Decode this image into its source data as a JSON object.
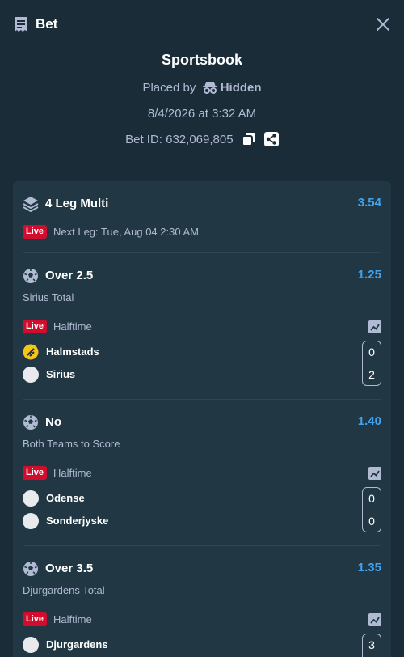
{
  "header": {
    "title": "Bet"
  },
  "summary": {
    "title": "Sportsbook",
    "placed_by_label": "Placed by",
    "placed_by_user": "Hidden",
    "datetime": "8/4/2026 at 3:32 AM",
    "bet_id": "Bet ID: 632,069,805"
  },
  "multi": {
    "title": "4 Leg Multi",
    "odds": "3.54",
    "live_label": "Live",
    "next_leg": "Next Leg: Tue, Aug 04 2:30 AM"
  },
  "legs": [
    {
      "selection": "Over 2.5",
      "odds": "1.25",
      "market": "Sirius Total",
      "live_label": "Live",
      "status": "Halftime",
      "teams": [
        {
          "name": "Halmstads",
          "score": "0"
        },
        {
          "name": "Sirius",
          "score": "2"
        }
      ]
    },
    {
      "selection": "No",
      "odds": "1.40",
      "market": "Both Teams to Score",
      "live_label": "Live",
      "status": "Halftime",
      "teams": [
        {
          "name": "Odense",
          "score": "0"
        },
        {
          "name": "Sonderjyske",
          "score": "0"
        }
      ]
    },
    {
      "selection": "Over 3.5",
      "odds": "1.35",
      "market": "Djurgardens Total",
      "live_label": "Live",
      "status": "Halftime",
      "teams": [
        {
          "name": "Djurgardens",
          "score": "3"
        }
      ]
    }
  ],
  "colors": {
    "background": "#1a2c38",
    "card": "#213743",
    "odds": "#3fa3f0",
    "live": "#d00d2d",
    "muted_text": "#b1bad3"
  },
  "icons": [
    "bet-slip-icon",
    "close-icon",
    "incognito-icon",
    "copy-icon",
    "share-icon",
    "layers-icon",
    "soccer-ball-icon",
    "chart-icon"
  ]
}
